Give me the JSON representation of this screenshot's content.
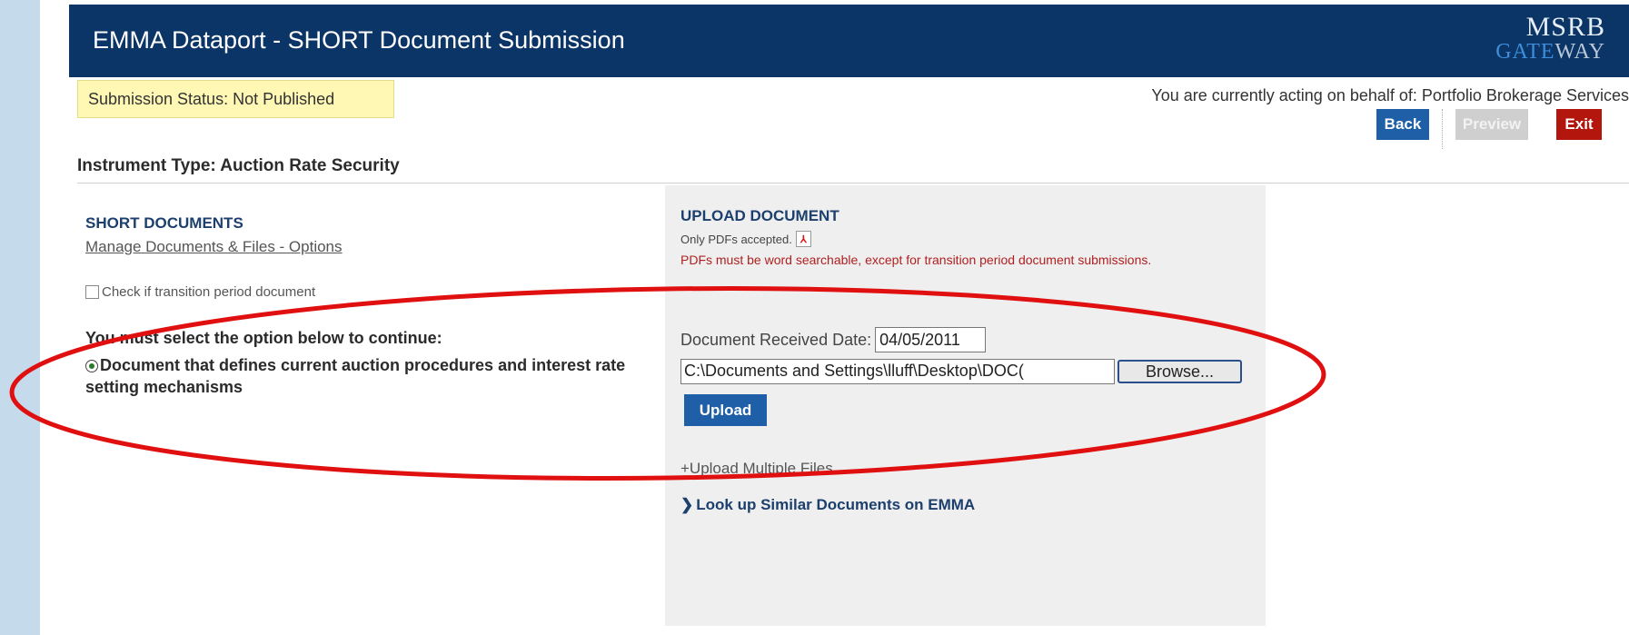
{
  "header": {
    "title": "EMMA Dataport - SHORT Document Submission",
    "brand_line1": "MSRB",
    "brand_line2_part1": "GATE",
    "brand_line2_part2": "WAY"
  },
  "status": {
    "text": "Submission Status: Not Published"
  },
  "acting": {
    "text": "You are currently acting on behalf of: Portfolio Brokerage Services"
  },
  "nav_buttons": {
    "back": "Back",
    "preview": "Preview",
    "exit": "Exit"
  },
  "instrument": {
    "text": "Instrument Type: Auction Rate Security"
  },
  "left": {
    "heading": "SHORT DOCUMENTS",
    "manage_link": "Manage Documents & Files - Options",
    "checkbox_label": "Check if transition period document",
    "must_select": "You must select the option below to continue:",
    "option_label": "Document that defines current auction procedures and interest rate setting mechanisms"
  },
  "upload": {
    "heading": "UPLOAD DOCUMENT",
    "only_pdfs": "Only PDFs accepted.",
    "pdf_note": "PDFs must be word searchable, except for transition period document submissions.",
    "date_label": "Document Received Date:",
    "date_value": "04/05/2011",
    "file_path": "C:\\Documents and Settings\\lluff\\Desktop\\DOC(",
    "browse_label": "Browse...",
    "upload_button": "Upload",
    "multiple_files": "+Upload Multiple Files",
    "lookup_link": "Look up Similar Documents on EMMA"
  },
  "colors": {
    "header_bg": "#0b3566",
    "status_bg": "#fff8b5",
    "button_blue": "#1f5fa8",
    "exit_red": "#b3160d",
    "annotation_red": "#e01010"
  }
}
